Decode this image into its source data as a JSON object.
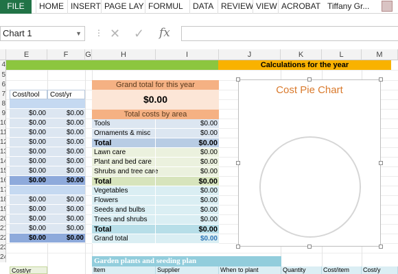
{
  "ribbon": {
    "file": "FILE",
    "tabs": [
      "HOME",
      "INSERT",
      "PAGE LAY",
      "FORMUL",
      "DATA",
      "REVIEW",
      "VIEW",
      "ACROBAT"
    ],
    "user": "Tiffany Gr..."
  },
  "formula_bar": {
    "name_box": "Chart 1",
    "fx": "fx"
  },
  "columns": [
    "E",
    "F",
    "G",
    "H",
    "I",
    "J",
    "K",
    "L",
    "M"
  ],
  "rows": [
    "4",
    "5",
    "6",
    "7",
    "8",
    "9",
    "10",
    "11",
    "12",
    "13",
    "14",
    "15",
    "16",
    "17",
    "18",
    "19",
    "20",
    "21",
    "22",
    "23",
    "24"
  ],
  "calc_banner": "Calculations for the year",
  "left_table": {
    "headers": [
      "Cost/tool",
      "Cost/yr"
    ],
    "value": "$0.00"
  },
  "summary": {
    "grand_total_label": "Grand total for this year",
    "grand_total_value": "$0.00",
    "by_area_label": "Total costs by area",
    "rows": [
      {
        "label": "Tools",
        "value": "$0.00"
      },
      {
        "label": "Ornaments & misc",
        "value": "$0.00"
      },
      {
        "label": "Total",
        "value": "$0.00"
      },
      {
        "label": "Lawn care",
        "value": "$0.00"
      },
      {
        "label": "Plant and bed care",
        "value": "$0.00"
      },
      {
        "label": "Shrubs and tree care",
        "value": "$0.00"
      },
      {
        "label": "Total",
        "value": "$0.00"
      },
      {
        "label": "Vegetables",
        "value": "$0.00"
      },
      {
        "label": "Flowers",
        "value": "$0.00"
      },
      {
        "label": "Seeds and bulbs",
        "value": "$0.00"
      },
      {
        "label": "Trees and shrubs",
        "value": "$0.00"
      },
      {
        "label": "Total",
        "value": "$0.00"
      },
      {
        "label": "Grand total",
        "value": "$0.00"
      }
    ]
  },
  "chart": {
    "title": "Cost Pie Chart"
  },
  "plan": {
    "title": "Garden plants and seeding plan",
    "columns": [
      "Item",
      "Supplier",
      "When to plant",
      "Quantity",
      "Cost/item",
      "Cost/y"
    ]
  },
  "bottom_left": "Cost/yr",
  "colors": {
    "excel_green": "#217346",
    "band_green": "#8cc63f",
    "band_gold": "#f9b200",
    "peach_header": "#f5b183",
    "chart_title": "#d9792b",
    "teal_header": "#92cddc"
  }
}
